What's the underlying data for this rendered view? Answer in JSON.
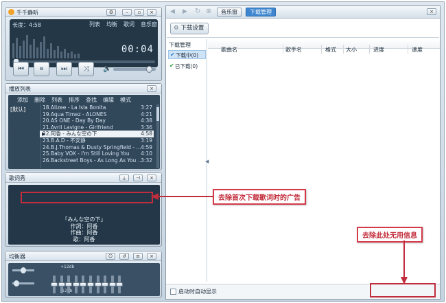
{
  "player": {
    "title": "千千静听",
    "duration_label": "长度：4:58",
    "tabs": [
      "列表",
      "均衡",
      "歌词",
      "音乐窗"
    ],
    "time": "00:04",
    "volume": 0.85
  },
  "playlist": {
    "title": "播放列表",
    "menu": [
      "添加",
      "删除",
      "列表",
      "排序",
      "查找",
      "编辑",
      "模式"
    ],
    "group": "[默认]",
    "tracks": [
      {
        "name": "18.Alizee - La Isla Bonita",
        "dur": "3:27"
      },
      {
        "name": "19.Aqua Timez - ALONES",
        "dur": "4:21"
      },
      {
        "name": "20.AS ONE - Day By Day",
        "dur": "4:38"
      },
      {
        "name": "21.Avril Lavigne - Girlfriend",
        "dur": "3:36"
      },
      {
        "name": "22.阿香 - みんな空の下",
        "dur": "4:58"
      },
      {
        "name": "23.B.A.D - 不安静",
        "dur": "3:19"
      },
      {
        "name": "24.B.J.Thomas & Dusty Springfield - ...",
        "dur": "4:59"
      },
      {
        "name": "25.Baby VOX - I'm Still Loving You",
        "dur": "4:10"
      },
      {
        "name": "26.Backstreet Boys - As Long As You ...",
        "dur": "3:32"
      }
    ]
  },
  "lyrics": {
    "title": "歌词秀",
    "lines": [
      "「みんな空の下」",
      "作詞：阿香",
      "作曲：阿香",
      "歌：阿香"
    ]
  },
  "equalizer": {
    "title": "均衡器",
    "top_label": "+12db",
    "bottom_label": "-12db",
    "bands": [
      0.5,
      0.5,
      0.5,
      0.5,
      0.5,
      0.5,
      0.5,
      0.5,
      0.5,
      0.5
    ]
  },
  "browser": {
    "tabs": [
      "音乐窗",
      "下载管理"
    ],
    "settings_button": "下载设置",
    "sidebar_header": "下载管理",
    "sidebar_items": [
      "下载中(0)",
      "已下载(0)"
    ],
    "columns": [
      "歌曲名",
      "歌手名",
      "格式",
      "大小",
      "进度",
      "速度"
    ],
    "footer_checkbox": "启动时自动显示"
  },
  "annotations": {
    "lyrics_ad": "去除首次下载歌词时的广告",
    "useless_info": "去除此处无用信息"
  },
  "colors": {
    "accent": "#2f84d8",
    "annotation": "#d33a4a"
  }
}
